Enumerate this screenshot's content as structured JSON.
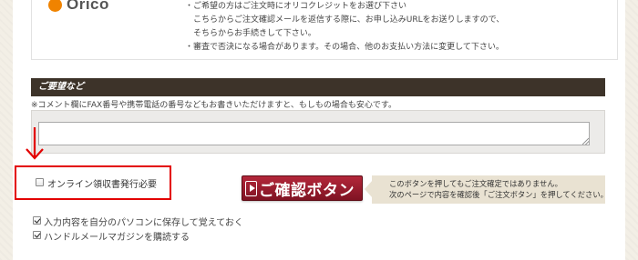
{
  "orico": {
    "logo_text": "Orico",
    "notes": [
      "・ご希望の方はご注文時にオリコクレジットをお選び下さい",
      "　こちらからご注文確認メールを返信する際に、お申し込みURLをお送りしますので、",
      "　そちらからお手続きして下さい。",
      "・審査で否決になる場合があります。その場合、他のお支払い方法に変更して下さい。"
    ]
  },
  "requests": {
    "heading": "ご要望など",
    "note": "※コメント欄にFAX番号や携帯電話の番号などもお書きいただけますと、もしもの場合も安心です。",
    "textarea_value": ""
  },
  "receipt": {
    "label": "オンライン領収書発行必要",
    "checked": false
  },
  "confirm_button": {
    "label": "ご確認ボタン"
  },
  "callout": {
    "line1": "このボタンを押してもご注文確定ではありません。",
    "line2": "次のページで内容を確認後「ご注文ボタン」を押してください。"
  },
  "options": [
    {
      "label": "入力内容を自分のパソコンに保存して覚えておく",
      "checked": true
    },
    {
      "label": "ハンドルメールマガジンを購読する",
      "checked": true
    }
  ],
  "colors": {
    "header_bg": "#3d3329",
    "button_red": "#a01f30",
    "highlight_red": "#e30000",
    "orico_orange": "#f08300"
  }
}
